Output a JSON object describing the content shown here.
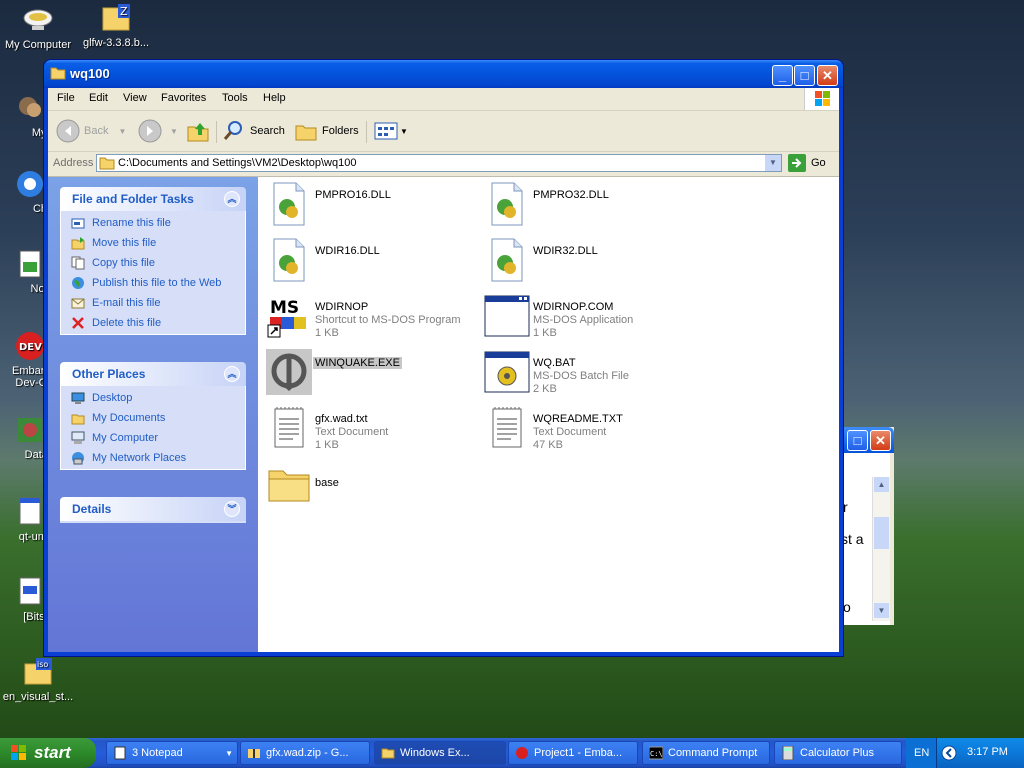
{
  "desktop": {
    "icons": [
      {
        "label": "My Computer"
      },
      {
        "label": "glfw-3.3.8.b..."
      },
      {
        "label": "MyPa"
      },
      {
        "label": "Chrom"
      },
      {
        "label": "Notepa"
      },
      {
        "label": "Embarc Dev-C"
      },
      {
        "label": "DataWa"
      },
      {
        "label": "qt-unified"
      },
      {
        "label": "[Bitsearc"
      },
      {
        "label": "en_visual_st..."
      }
    ]
  },
  "window": {
    "title": "wq100",
    "menu": [
      "File",
      "Edit",
      "View",
      "Favorites",
      "Tools",
      "Help"
    ],
    "toolbar": {
      "back": "Back",
      "search": "Search",
      "folders": "Folders"
    },
    "address": {
      "label": "Address",
      "value": "C:\\Documents and Settings\\VM2\\Desktop\\wq100",
      "go": "Go"
    },
    "tasks": {
      "file_tasks": {
        "title": "File and Folder Tasks",
        "items": [
          "Rename this file",
          "Move this file",
          "Copy this file",
          "Publish this file to the Web",
          "E-mail this file",
          "Delete this file"
        ]
      },
      "other_places": {
        "title": "Other Places",
        "items": [
          "Desktop",
          "My Documents",
          "My Computer",
          "My Network Places"
        ]
      },
      "details": {
        "title": "Details"
      }
    },
    "files": [
      {
        "name": "PMPRO16.DLL",
        "type": "",
        "size": "",
        "icon": "dll-icon"
      },
      {
        "name": "PMPRO32.DLL",
        "type": "",
        "size": "",
        "icon": "dll-icon"
      },
      {
        "name": "WDIR16.DLL",
        "type": "",
        "size": "",
        "icon": "dll-icon"
      },
      {
        "name": "WDIR32.DLL",
        "type": "",
        "size": "",
        "icon": "dll-icon"
      },
      {
        "name": "WDIRNOP",
        "type": "Shortcut to MS-DOS Program",
        "size": "1 KB",
        "icon": "msdos-shortcut-icon"
      },
      {
        "name": "WDIRNOP.COM",
        "type": "MS-DOS Application",
        "size": "1 KB",
        "icon": "msdos-app-icon"
      },
      {
        "name": "WINQUAKE.EXE",
        "type": "",
        "size": "",
        "icon": "quake-icon",
        "selected": true
      },
      {
        "name": "WQ.BAT",
        "type": "MS-DOS Batch File",
        "size": "2 KB",
        "icon": "batch-file-icon"
      },
      {
        "name": "gfx.wad.txt",
        "type": "Text Document",
        "size": "1 KB",
        "icon": "text-document-icon"
      },
      {
        "name": "WQREADME.TXT",
        "type": "Text Document",
        "size": "47 KB",
        "icon": "text-document-icon"
      },
      {
        "name": "base",
        "type": "",
        "size": "",
        "icon": "folder-icon"
      }
    ]
  },
  "background_window": {
    "text_fragments": [
      "r",
      "st a",
      "o"
    ]
  },
  "taskbar": {
    "start": "start",
    "tasks": [
      {
        "label": "3 Notepad"
      },
      {
        "label": "gfx.wad.zip - G..."
      },
      {
        "label": "Windows Ex..."
      },
      {
        "label": "Project1 - Emba..."
      },
      {
        "label": "Command Prompt"
      },
      {
        "label": "Calculator Plus"
      }
    ],
    "language": "EN",
    "clock": "3:17 PM"
  },
  "colors": {
    "xp_blue": "#0453dc",
    "task_link": "#215dc6",
    "selection": "#316ac5"
  }
}
